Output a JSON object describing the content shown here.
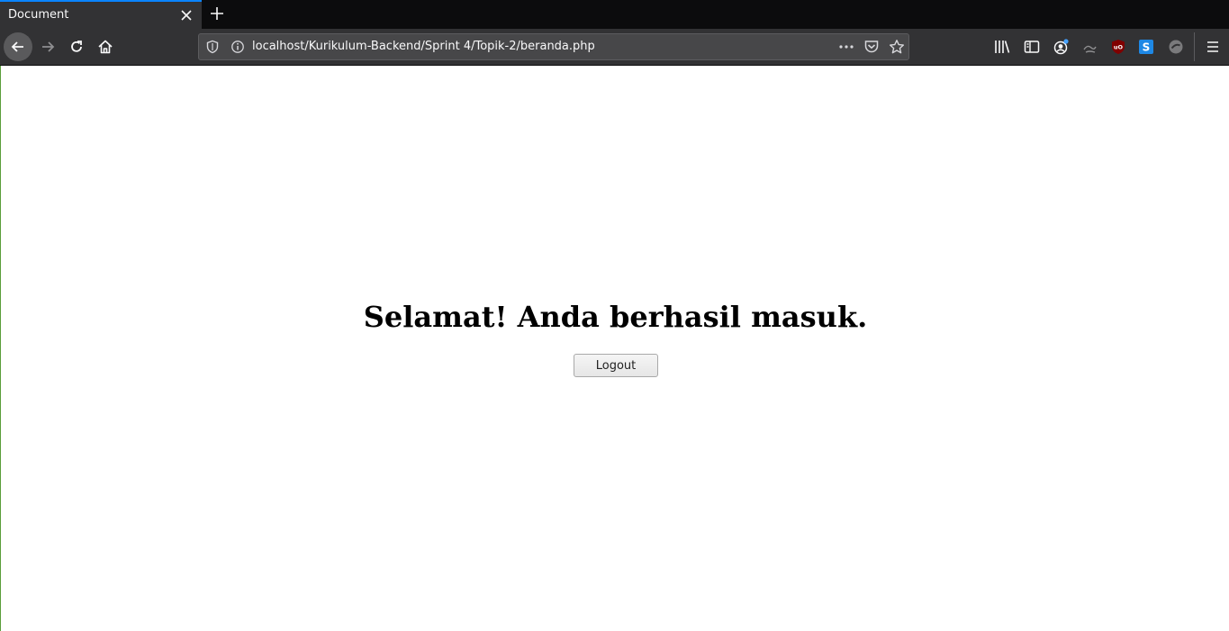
{
  "browser": {
    "tab": {
      "title": "Document",
      "close_icon": "close-icon"
    },
    "new_tab_icon": "plus-icon",
    "nav": {
      "back_icon": "arrow-left-icon",
      "forward_icon": "arrow-right-icon",
      "reload_icon": "reload-icon",
      "home_icon": "home-icon"
    },
    "urlbar": {
      "url": "localhost/Kurikulum-Backend/Sprint 4/Topik-2/beranda.php",
      "icons": [
        "shield-icon",
        "info-icon",
        "more-dots-icon",
        "pocket-icon",
        "star-icon"
      ]
    },
    "toolbar_icons": [
      "library-icon",
      "sidebar-icon",
      "account-icon",
      "extension-icon",
      "ublock-icon",
      "s-extension-icon",
      "blocked-icon",
      "hamburger-menu-icon"
    ],
    "colors": {
      "tab_accent": "#0a84ff",
      "chrome_dark": "#0c0c0d",
      "toolbar": "#323234",
      "urlbar": "#474749"
    }
  },
  "page": {
    "heading": "Selamat! Anda berhasil masuk.",
    "logout_button": "Logout"
  }
}
